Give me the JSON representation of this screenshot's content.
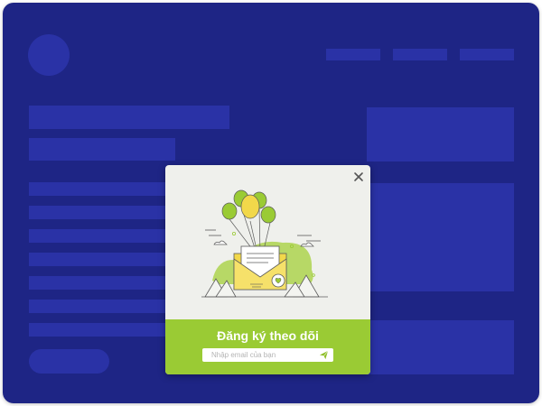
{
  "popup": {
    "title": "Đăng ký theo dõi",
    "email_placeholder": "Nhập email của bạn",
    "close_icon": "close-icon",
    "send_icon": "send-icon",
    "illustration": "envelope-balloons-illustration"
  },
  "colors": {
    "background": "#1e2585",
    "placeholder_block": "#2a32a6",
    "popup_body": "#eff0ec",
    "popup_footer": "#9acb34"
  }
}
